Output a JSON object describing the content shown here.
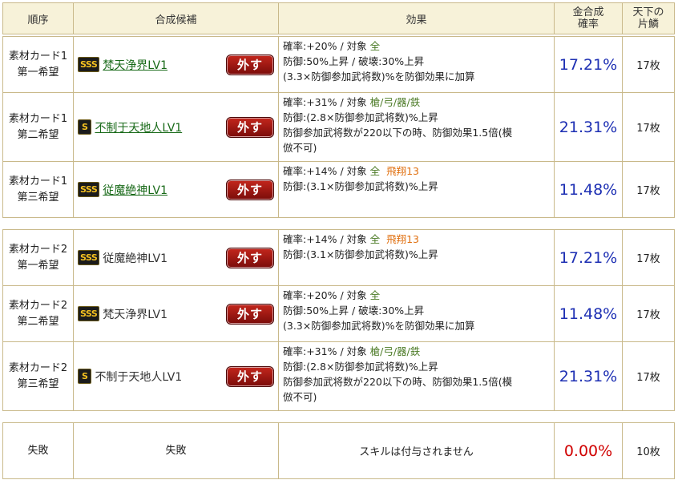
{
  "headers": {
    "order": "順序",
    "candidate": "合成候補",
    "effect": "効果",
    "rate_l1": "金合成",
    "rate_l2": "確率",
    "scale_l1": "天下の",
    "scale_l2": "片鱗"
  },
  "remove_label": "外す",
  "groups": [
    {
      "rows": [
        {
          "order1": "素材カード1",
          "order2": "第一希望",
          "rank": "SSS",
          "name": "梵天浄界LV1",
          "linked": true,
          "rate_line": "確率:+20%  /  対象  ",
          "targets": "全",
          "hisho": "",
          "lines": [
            "防御:50%上昇  /  破壊:30%上昇",
            "(3.3×防御参加武将数)%を防御効果に加算"
          ],
          "rate": "17.21%",
          "scale": "17枚"
        },
        {
          "order1": "素材カード1",
          "order2": "第二希望",
          "rank": "S",
          "name": "不制于天地人LV1",
          "linked": true,
          "rate_line": "確率:+31%  /  対象  ",
          "targets": "槍/弓/器/鉄",
          "hisho": "",
          "lines": [
            "防御:(2.8×防御参加武将数)%上昇",
            "防御参加武将数が220以下の時、防御効果1.5倍(模",
            "倣不可)"
          ],
          "rate": "21.31%",
          "scale": "17枚"
        },
        {
          "order1": "素材カード1",
          "order2": "第三希望",
          "rank": "SSS",
          "name": "従魔絶神LV1",
          "linked": true,
          "rate_line": "確率:+14%  /  対象  ",
          "targets": "全",
          "hisho": "飛翔13",
          "lines": [
            "防御:(3.1×防御参加武将数)%上昇"
          ],
          "rate": "11.48%",
          "scale": "17枚"
        }
      ]
    },
    {
      "rows": [
        {
          "order1": "素材カード2",
          "order2": "第一希望",
          "rank": "SSS",
          "name": "従魔絶神LV1",
          "linked": false,
          "rate_line": "確率:+14%  /  対象  ",
          "targets": "全",
          "hisho": "飛翔13",
          "lines": [
            "防御:(3.1×防御参加武将数)%上昇"
          ],
          "rate": "17.21%",
          "scale": "17枚"
        },
        {
          "order1": "素材カード2",
          "order2": "第二希望",
          "rank": "SSS",
          "name": "梵天浄界LV1",
          "linked": false,
          "rate_line": "確率:+20%  /  対象  ",
          "targets": "全",
          "hisho": "",
          "lines": [
            "防御:50%上昇  /  破壊:30%上昇",
            "(3.3×防御参加武将数)%を防御効果に加算"
          ],
          "rate": "11.48%",
          "scale": "17枚"
        },
        {
          "order1": "素材カード2",
          "order2": "第三希望",
          "rank": "S",
          "name": "不制于天地人LV1",
          "linked": false,
          "rate_line": "確率:+31%  /  対象  ",
          "targets": "槍/弓/器/鉄",
          "hisho": "",
          "lines": [
            "防御:(2.8×防御参加武将数)%上昇",
            "防御参加武将数が220以下の時、防御効果1.5倍(模",
            "倣不可)"
          ],
          "rate": "21.31%",
          "scale": "17枚"
        }
      ]
    }
  ],
  "fail": {
    "order": "失敗",
    "candidate": "失敗",
    "effect": "スキルは付与されません",
    "rate": "0.00%",
    "scale": "10枚"
  },
  "colors": {
    "rate": "#1d2fb3",
    "fail_rate": "#d00000",
    "target": "#4b7a25",
    "hisho": "#e07010",
    "link": "#196a19",
    "header_bg": "#f7f2d9",
    "border": "#c9b98a"
  }
}
